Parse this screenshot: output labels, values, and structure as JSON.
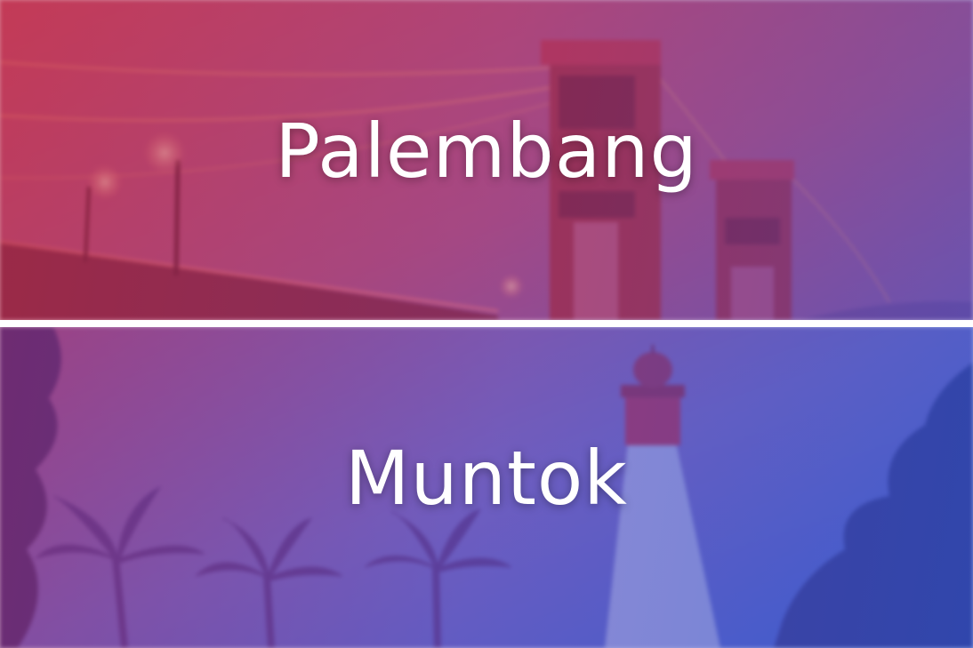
{
  "panels": [
    {
      "id": "palembang",
      "city": "Palembang",
      "scene": "bridge-photo",
      "tint_colors": [
        "#b92846",
        "#963278",
        "#5a46aa"
      ]
    },
    {
      "id": "muntok",
      "city": "Muntok",
      "scene": "lighthouse-photo",
      "tint_colors": [
        "#8c2d78",
        "#5a46b4",
        "#2850c8"
      ]
    }
  ]
}
